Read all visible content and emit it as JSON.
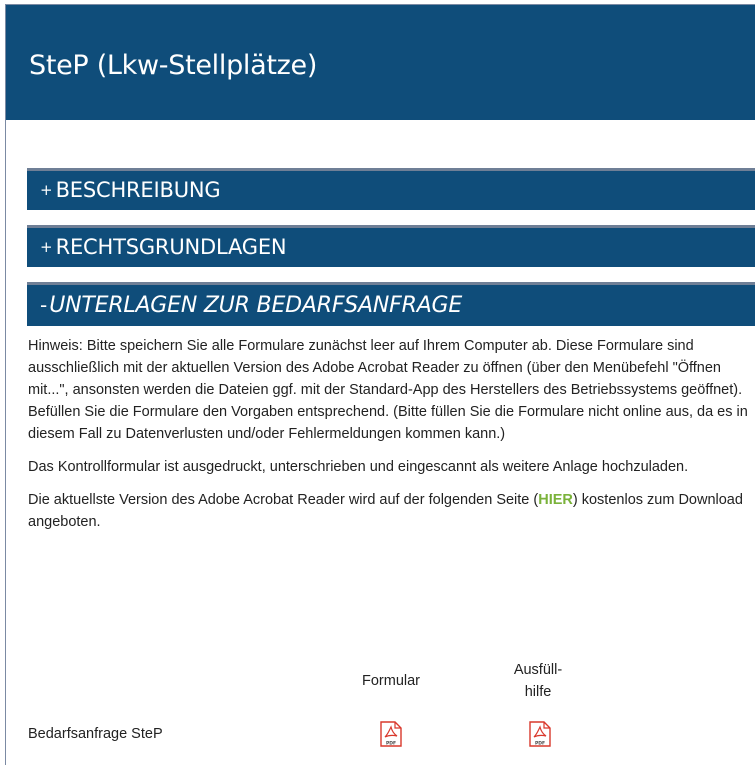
{
  "header": {
    "title": "SteP (Lkw-Stellplätze)"
  },
  "accordion": [
    {
      "sign": "+",
      "label": "BESCHREIBUNG"
    },
    {
      "sign": "+",
      "label": "RECHTSGRUNDLAGEN"
    },
    {
      "sign": "-",
      "label": "UNTERLAGEN ZUR BEDARFSANFRAGE"
    }
  ],
  "content": {
    "hint": "Hinweis: Bitte speichern Sie alle Formulare zunächst leer auf Ihrem Computer ab. Diese Formulare sind ausschließlich mit der aktuellen Version des Adobe Acrobat Reader zu öffnen (über den Menübefehl \"Öffnen mit...\", ansonsten werden die Dateien ggf. mit der Standard-App des Herstellers des Betriebssystems geöffnet). Befüllen Sie die Formulare den Vorgaben entsprechend. (Bitte füllen Sie die Formulare nicht online aus, da es in diesem Fall zu Datenverlusten und/oder Fehlermeldungen kommen kann.)",
    "control": "Das Kontrollformular ist ausgedruckt, unterschrieben und eingescannt als weitere Anlage hochzuladen.",
    "download_before": "Die aktuellste Version des Adobe Acrobat Reader wird auf der folgenden Seite (",
    "download_link": "HIER",
    "download_after": ") kostenlos zum Download angeboten."
  },
  "table": {
    "col_formular": "Formular",
    "col_hilfe_1": "Ausfüll-",
    "col_hilfe_2": "hilfe",
    "row_label": "Bedarfsanfrage SteP",
    "pdf_text": "PDF"
  },
  "colors": {
    "brand": "#0f4d7a",
    "link": "#7ab23a",
    "pdf_red": "#d9382c"
  },
  "icons": [
    "pdf-icon"
  ]
}
